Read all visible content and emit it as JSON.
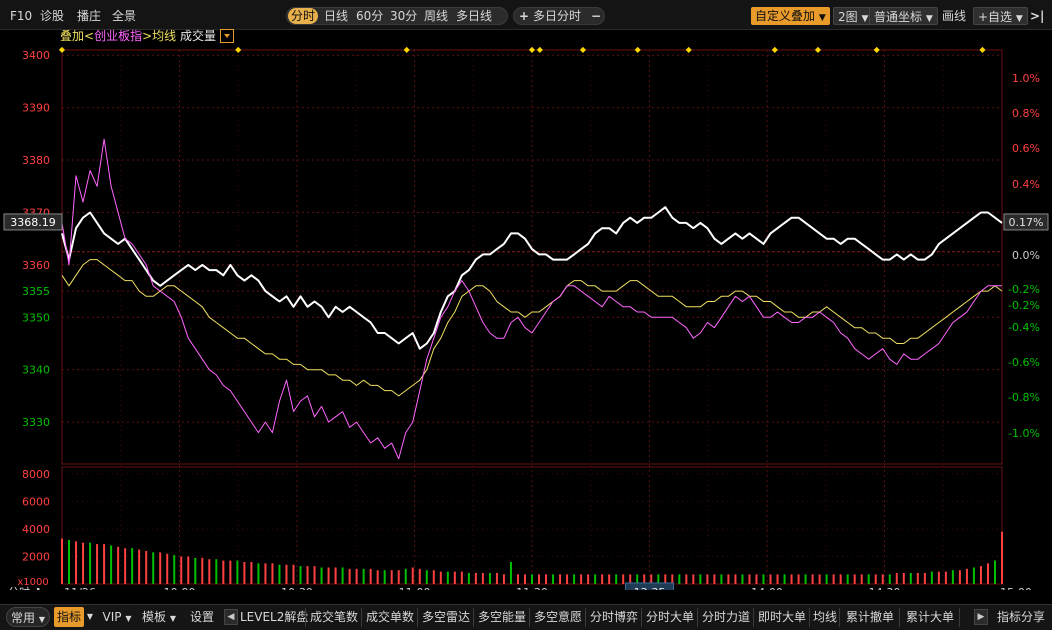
{
  "topbar": {
    "left_items": [
      "F10",
      "诊股",
      "播庄",
      "全景"
    ],
    "period_tabs": [
      {
        "label": "分时",
        "active": true
      },
      {
        "label": "日线",
        "active": false
      },
      {
        "label": "60分",
        "active": false
      },
      {
        "label": "30分",
        "active": false
      },
      {
        "label": "周线",
        "active": false
      },
      {
        "label": "多日线",
        "active": false
      }
    ],
    "multiday": {
      "plus": "+",
      "label": "多日分时",
      "minus": "−"
    },
    "custom_overlay": "自定义叠加",
    "chart_count": "2图",
    "coord": "普通坐标",
    "draw": "画线",
    "watchlist": "+自选",
    "collapse_icon": "collapse-icon"
  },
  "legend": {
    "overlay": "叠加<",
    "index_name": "创业板指",
    "sep": ">",
    "avg_line": "均线",
    "volume": "成交量"
  },
  "colors": {
    "price_line": "#ffffff",
    "avg_line": "#f0e060",
    "overlay_line": "#ff66ff",
    "up": "#ff4040",
    "down": "#00c000",
    "grid": "#5a1010",
    "axis_left": "#ff4040",
    "axis_right_pos": "#ff4040",
    "axis_right_neg": "#00c000",
    "marker": "#ffd800"
  },
  "chart_data": {
    "type": "line",
    "x": [
      "09:30",
      "10:00",
      "10:30",
      "11:00",
      "11:30",
      "14:00",
      "14:30",
      "15:00"
    ],
    "x_tick_labels": [
      "11/26",
      "10:00",
      "10:30",
      "11:00",
      "11:30",
      "13:35",
      "14:00",
      "14:30",
      "15:00"
    ],
    "highlighted_x_label": "13:35",
    "y_left_ticks": [
      3400,
      3390,
      3380,
      3370,
      3360,
      3355,
      3350,
      3340,
      3330
    ],
    "y_left_ticks_green": [
      3355,
      3350,
      3340,
      3330
    ],
    "ylim": [
      3322,
      3401
    ],
    "prev_close": 3362.5,
    "current_price_label": "3368.19",
    "current_pct_label": "0.17%",
    "y_right_ticks": [
      "1.0%",
      "0.8%",
      "0.6%",
      "0.4%",
      "0.2%",
      "0.0%",
      "-0.2%",
      "-0.2%",
      "-0.4%",
      "-0.6%",
      "-0.8%",
      "-1.0%"
    ],
    "series": [
      {
        "name": "",
        "role": "price",
        "values": [
          3366,
          3361,
          3367,
          3369,
          3370,
          3368,
          3366,
          3365,
          3364,
          3365,
          3363,
          3361,
          3359,
          3357,
          3356,
          3357,
          3358,
          3359,
          3360,
          3359,
          3360,
          3359,
          3359,
          3358,
          3360,
          3358,
          3357,
          3358,
          3357,
          3355,
          3354,
          3353,
          3354,
          3352,
          3354,
          3352,
          3353,
          3352,
          3350,
          3352,
          3351,
          3352,
          3351,
          3350,
          3349,
          3347,
          3347,
          3346,
          3345,
          3346,
          3347,
          3344,
          3345,
          3347,
          3351,
          3354,
          3355,
          3358,
          3359,
          3361,
          3362,
          3362,
          3363,
          3364,
          3366,
          3366,
          3365,
          3363,
          3362,
          3362,
          3361,
          3361,
          3361,
          3362,
          3363,
          3364,
          3366,
          3367,
          3367,
          3366,
          3368,
          3369,
          3368,
          3369,
          3369,
          3370,
          3371,
          3369,
          3368,
          3368,
          3367,
          3368,
          3367,
          3365,
          3364,
          3365,
          3366,
          3365,
          3366,
          3365,
          3364,
          3366,
          3367,
          3368,
          3369,
          3369,
          3368,
          3367,
          3366,
          3365,
          3365,
          3364,
          3365,
          3365,
          3364,
          3363,
          3362,
          3361,
          3361,
          3362,
          3361,
          3362,
          3361,
          3361,
          3362,
          3364,
          3365,
          3366,
          3367,
          3368,
          3369,
          3370,
          3370,
          3369,
          3368
        ],
        "color": "#ffffff"
      },
      {
        "name": "均线",
        "role": "avg",
        "values": [
          3358,
          3356,
          3358,
          3360,
          3361,
          3361,
          3360,
          3359,
          3358,
          3357,
          3357,
          3355,
          3354,
          3354,
          3355,
          3356,
          3356,
          3355,
          3354,
          3353,
          3352,
          3350,
          3349,
          3348,
          3347,
          3346,
          3346,
          3345,
          3344,
          3343,
          3343,
          3342,
          3342,
          3341,
          3341,
          3340,
          3340,
          3340,
          3339,
          3339,
          3338,
          3338,
          3337,
          3338,
          3337,
          3337,
          3336,
          3336,
          3335,
          3336,
          3337,
          3338,
          3340,
          3344,
          3346,
          3349,
          3351,
          3354,
          3355,
          3356,
          3356,
          3355,
          3353,
          3352,
          3351,
          3351,
          3350,
          3351,
          3351,
          3352,
          3353,
          3354,
          3356,
          3357,
          3357,
          3356,
          3356,
          3355,
          3355,
          3355,
          3356,
          3357,
          3357,
          3356,
          3355,
          3354,
          3354,
          3354,
          3353,
          3352,
          3352,
          3352,
          3353,
          3353,
          3354,
          3354,
          3355,
          3355,
          3354,
          3354,
          3353,
          3353,
          3352,
          3351,
          3351,
          3350,
          3350,
          3351,
          3351,
          3352,
          3351,
          3350,
          3349,
          3348,
          3348,
          3347,
          3347,
          3346,
          3346,
          3345,
          3345,
          3346,
          3346,
          3347,
          3348,
          3349,
          3350,
          3351,
          3352,
          3353,
          3354,
          3355,
          3355,
          3356,
          3355
        ],
        "color": "#f0e060"
      },
      {
        "name": "创业板指",
        "role": "overlay",
        "values": [
          3368,
          3360,
          3377,
          3372,
          3378,
          3375,
          3384,
          3375,
          3370,
          3365,
          3364,
          3362,
          3360,
          3356,
          3355,
          3354,
          3353,
          3350,
          3346,
          3344,
          3342,
          3340,
          3339,
          3337,
          3336,
          3334,
          3332,
          3330,
          3328,
          3330,
          3328,
          3334,
          3338,
          3332,
          3334,
          3335,
          3331,
          3333,
          3330,
          3331,
          3332,
          3329,
          3330,
          3328,
          3326,
          3327,
          3325,
          3326,
          3323,
          3328,
          3330,
          3336,
          3342,
          3346,
          3350,
          3352,
          3355,
          3357,
          3355,
          3352,
          3349,
          3347,
          3346,
          3346,
          3349,
          3350,
          3348,
          3347,
          3349,
          3351,
          3353,
          3354,
          3356,
          3356,
          3355,
          3354,
          3353,
          3352,
          3354,
          3353,
          3352,
          3352,
          3351,
          3351,
          3350,
          3350,
          3350,
          3350,
          3349,
          3348,
          3346,
          3347,
          3349,
          3348,
          3350,
          3352,
          3354,
          3353,
          3354,
          3352,
          3350,
          3350,
          3351,
          3350,
          3349,
          3349,
          3350,
          3350,
          3351,
          3350,
          3349,
          3347,
          3346,
          3344,
          3343,
          3342,
          3343,
          3344,
          3342,
          3341,
          3343,
          3342,
          3342,
          3343,
          3344,
          3345,
          3347,
          3349,
          3350,
          3351,
          3353,
          3355,
          3356,
          3356,
          3356
        ],
        "color": "#ff66ff"
      }
    ],
    "volume": {
      "y_ticks": [
        8000,
        6000,
        4000,
        2000
      ],
      "unit_label": "x1000",
      "ylim": [
        0,
        8500
      ],
      "values": [
        3300,
        3200,
        3100,
        3000,
        3000,
        2900,
        2900,
        2800,
        2700,
        2600,
        2600,
        2500,
        2400,
        2300,
        2300,
        2200,
        2100,
        2000,
        2000,
        1900,
        1900,
        1800,
        1800,
        1700,
        1700,
        1700,
        1600,
        1600,
        1500,
        1500,
        1500,
        1400,
        1400,
        1400,
        1300,
        1300,
        1300,
        1200,
        1200,
        1200,
        1200,
        1100,
        1100,
        1100,
        1100,
        1000,
        1000,
        1000,
        1000,
        1100,
        1200,
        1100,
        1000,
        1000,
        900,
        900,
        900,
        900,
        800,
        800,
        800,
        800,
        800,
        700,
        1600,
        700,
        700,
        700,
        700,
        700,
        700,
        700,
        700,
        700,
        700,
        700,
        700,
        700,
        700,
        700,
        700,
        700,
        700,
        700,
        700,
        700,
        700,
        700,
        700,
        700,
        700,
        700,
        700,
        700,
        700,
        700,
        700,
        700,
        700,
        700,
        700,
        700,
        700,
        700,
        700,
        700,
        700,
        700,
        700,
        700,
        700,
        700,
        700,
        700,
        700,
        700,
        700,
        700,
        700,
        800,
        800,
        800,
        800,
        800,
        900,
        900,
        900,
        1000,
        1000,
        1100,
        1200,
        1300,
        1500,
        1700,
        3800
      ],
      "colors": "alternating"
    },
    "event_markers": [
      "◆",
      "◆",
      "◆",
      "◆",
      "◆",
      "◆",
      "◆",
      "◆",
      "◆",
      "◆",
      "◆",
      "◆"
    ],
    "grid": true
  },
  "bottom": {
    "period_label": "分时",
    "tabs_left": [
      {
        "label": "常用",
        "dropdown": true
      },
      {
        "label": "指标",
        "dropdown": true,
        "selected": true
      },
      {
        "label": "VIP",
        "dropdown": true
      },
      {
        "label": "模板",
        "dropdown": true
      },
      {
        "label": "设置",
        "dropdown": false
      }
    ],
    "tabs_right": [
      "LEVEL2解盘",
      "成交笔数",
      "成交单数",
      "多空雷达",
      "多空能量",
      "多空意愿",
      "分时博弈",
      "分时大单",
      "分时力道",
      "即时大单",
      "均线",
      "累计撤单",
      "累计大单"
    ],
    "last_tab": "指标分享"
  }
}
